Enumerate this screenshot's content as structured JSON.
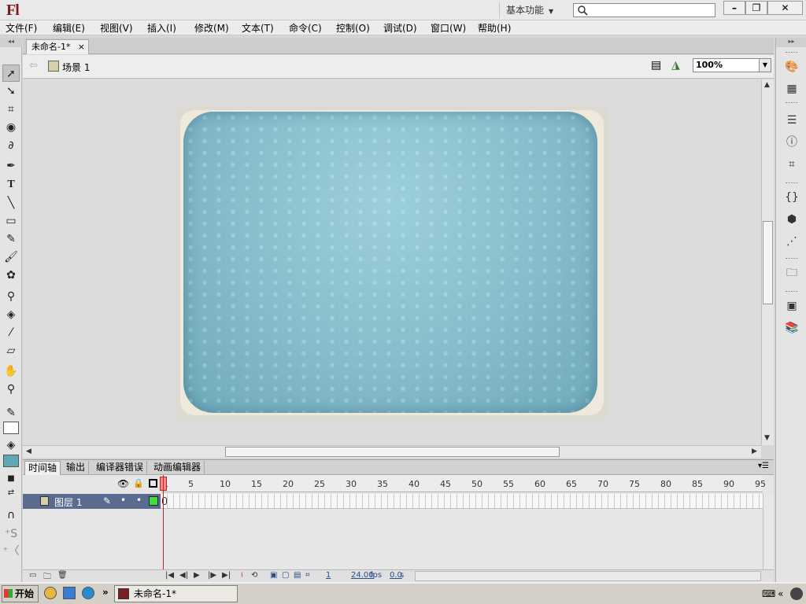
{
  "app": {
    "logo": "Fl",
    "workspace": "基本功能",
    "search_placeholder": ""
  },
  "menu": [
    "文件(F)",
    "编辑(E)",
    "视图(V)",
    "插入(I)",
    "修改(M)",
    "文本(T)",
    "命令(C)",
    "控制(O)",
    "调试(D)",
    "窗口(W)",
    "帮助(H)"
  ],
  "document": {
    "tab": "未命名-1*",
    "close": "×",
    "scene": "场景 1",
    "zoom": "100%"
  },
  "tools": [
    "selection-tool-icon",
    "subselection-tool-icon",
    "free-transform-tool-icon",
    "3d-rotation-tool-icon",
    "lasso-tool-icon",
    "pen-tool-icon",
    "text-tool-icon",
    "line-tool-icon",
    "rectangle-tool-icon",
    "pencil-tool-icon",
    "brush-tool-icon",
    "deco-tool-icon",
    "bone-tool-icon",
    "paint-bucket-tool-icon",
    "eyedropper-tool-icon",
    "eraser-tool-icon",
    "hand-tool-icon",
    "zoom-tool-icon"
  ],
  "colors": {
    "stage_card": "#7fb6c7",
    "layer_row": "#5a6b8f",
    "keyframe": "#3fdc3f",
    "playhead": "#d02020"
  },
  "timeline": {
    "tabs": [
      "时间轴",
      "输出",
      "编译器错误",
      "动画编辑器"
    ],
    "ruler": [
      "1",
      "5",
      "10",
      "15",
      "20",
      "25",
      "30",
      "35",
      "40",
      "45",
      "50",
      "55",
      "60",
      "65",
      "70",
      "75",
      "80",
      "85",
      "90",
      "95"
    ],
    "layer_name": "图层 1",
    "current_frame": "1",
    "fps": "24.00",
    "fps_unit": "fps",
    "time": "0.0",
    "time_unit": "s"
  },
  "taskbar": {
    "start": "开始",
    "item": "未命名-1*",
    "chevron": "»"
  }
}
